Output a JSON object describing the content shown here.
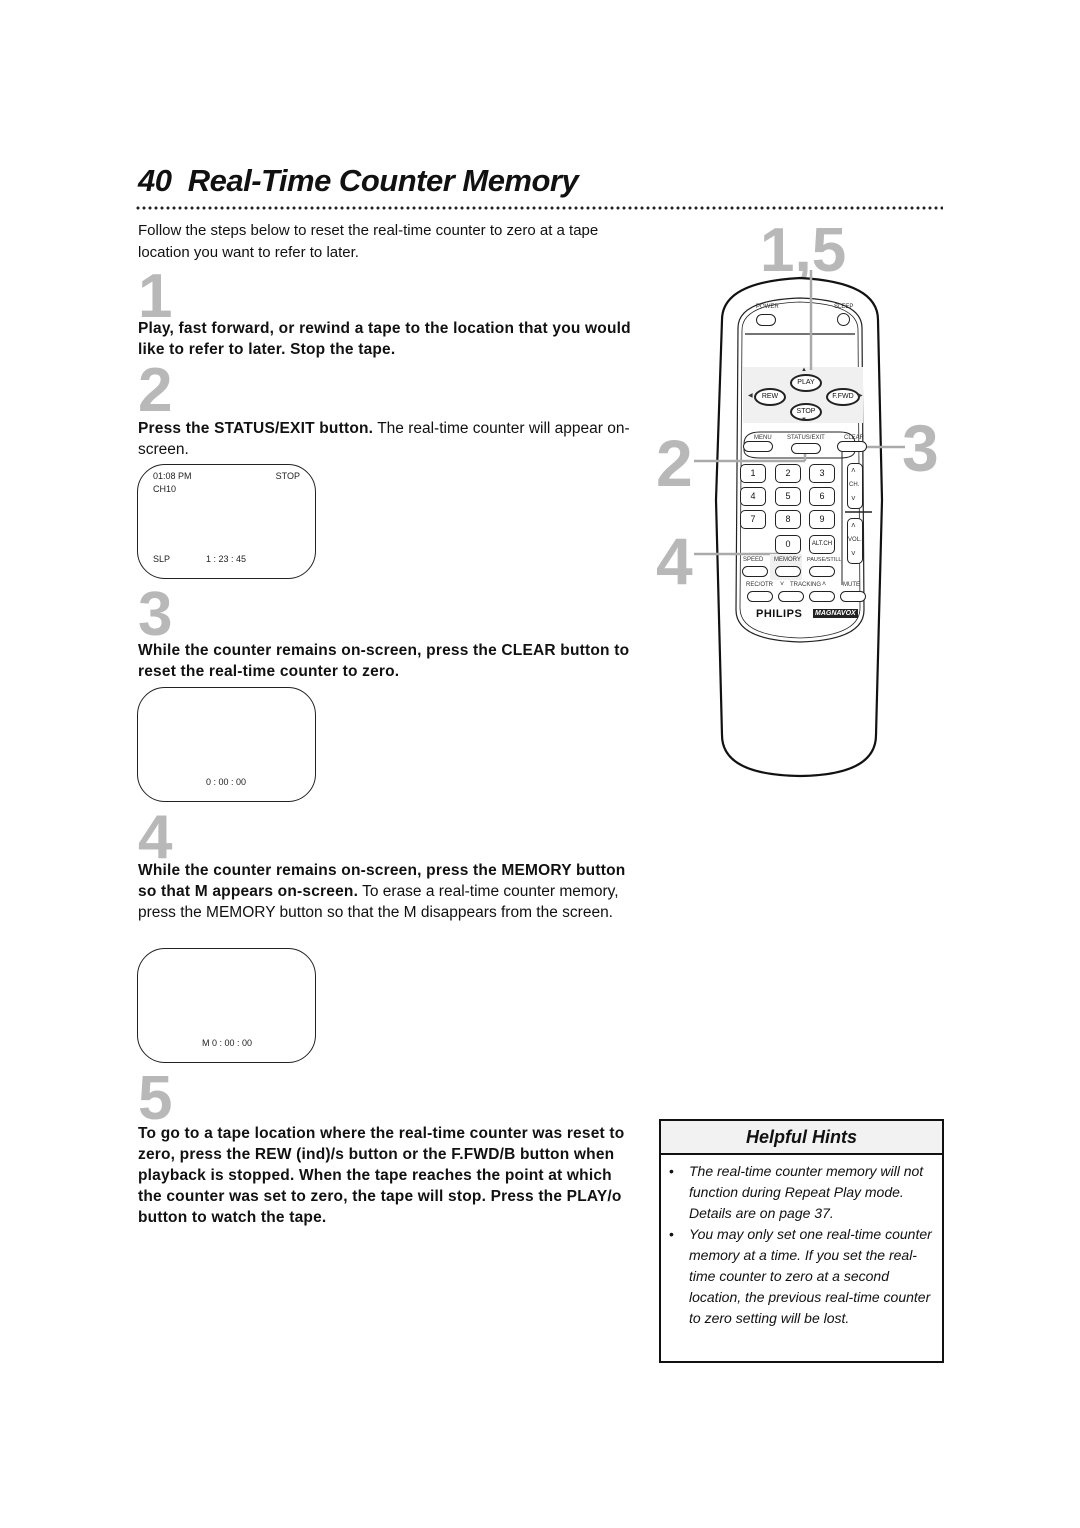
{
  "page": {
    "number": "40",
    "title": "Real-Time Counter Memory",
    "intro": "Follow the steps below to reset the real-time counter to zero at a tape location you want to refer to later."
  },
  "steps": [
    {
      "number": "1",
      "bold": "Play, fast forward, or rewind a tape to the location that you would like to refer to later.  Stop the tape.",
      "normal": ""
    },
    {
      "number": "2",
      "bold": "Press the STATUS/EXIT button.",
      "normal": " The real-time counter will appear on-screen.",
      "screen": {
        "time": "01:08 PM",
        "status": "STOP",
        "channel": "CH10",
        "speed": "SLP",
        "counter": "1 : 23 : 45"
      }
    },
    {
      "number": "3",
      "bold": "While the counter remains on-screen, press the CLEAR button to reset the real-time counter to zero.",
      "normal": "",
      "screen": {
        "counter": "0 : 00 : 00"
      }
    },
    {
      "number": "4",
      "bold": "While the counter remains on-screen, press the MEMORY button so that M appears on-screen.",
      "normal": " To erase a real-time counter memory, press the MEMORY button so that the M disappears from the screen.",
      "screen": {
        "counter": "M  0 : 00 : 00"
      }
    },
    {
      "number": "5",
      "bold": "To go to a tape location where the real-time counter was reset to zero, press the REW (ind)/s  button or the F.FWD/B  button when playback is stopped. When the tape reaches the point at which the counter was set to zero, the tape will stop. Press the PLAY/o  button to watch the tape.",
      "normal": ""
    }
  ],
  "hints": {
    "title": "Helpful Hints",
    "items": [
      "The real-time counter memory will not function during Repeat Play mode.  Details are on page 37.",
      "You may only set one real-time counter memory at a time. If you set the real-time counter to zero at a second location, the previous real-time counter to zero setting will be lost."
    ]
  },
  "remote": {
    "callouts": {
      "top": "1,5",
      "left_upper": "2",
      "right": "3",
      "left_lower": "4"
    },
    "buttons": {
      "power": "POWER",
      "sleep": "SLEEP",
      "play": "PLAY",
      "rew": "REW",
      "ffwd": "F.FWD",
      "stop": "STOP",
      "menu": "MENU",
      "status_exit": "STATUS/EXIT",
      "clear": "CLEAR",
      "digits": [
        "1",
        "2",
        "3",
        "4",
        "5",
        "6",
        "7",
        "8",
        "9"
      ],
      "zero": "0",
      "alt_ch": "ALT.CH",
      "ch": "CH.",
      "vol": "VOL.",
      "speed": "SPEED",
      "memory": "MEMORY",
      "pause_still": "PAUSE/STILL",
      "rec_otr": "REC/OTR",
      "tracking": "TRACKING",
      "mute": "MUTE"
    },
    "brand_1": "PHILIPS",
    "brand_2": "MAGNAVOX",
    "highlight_color": "#f0f0f0",
    "callout_color": "#b8b8b8"
  }
}
